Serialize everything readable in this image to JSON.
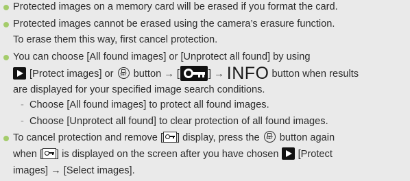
{
  "notes": [
    {
      "text": "Protected images on a memory card will be erased if you format the card."
    },
    {
      "line1": "Protected images cannot be erased using the camera’s erasure function.",
      "line2": "To erase them this way, first cancel protection."
    },
    {
      "line1": "You can choose [All found images] or [Unprotect all found] by using",
      "line2": {
        "a": " [Protect images] or ",
        "b": " button → [",
        "c": "] → ",
        "info": "INFO",
        "d": " button when results"
      },
      "line3": "are displayed for your specified image search conditions.",
      "sub": [
        {
          "dash": "-",
          "text": "Choose [All found images] to protect all found images."
        },
        {
          "dash": "-",
          "text": "Choose [Unprotect all found] to clear protection of all found images."
        }
      ]
    },
    {
      "line1": {
        "a": "To cancel protection and remove [",
        "b": "] display, press the ",
        "c": " button again"
      },
      "line2": {
        "a": "when [",
        "b": "] is displayed on the screen after you have chosen ",
        "c": " [Protect"
      },
      "line3": "images] → [Select images]."
    }
  ],
  "colors": {
    "background": "#eaeaea",
    "bullet": "#a4cc6b",
    "text": "#2b2b2b"
  },
  "icons": [
    "play-button-icon",
    "func-set-button-icon",
    "protect-key-icon",
    "protect-key-frame-icon"
  ]
}
